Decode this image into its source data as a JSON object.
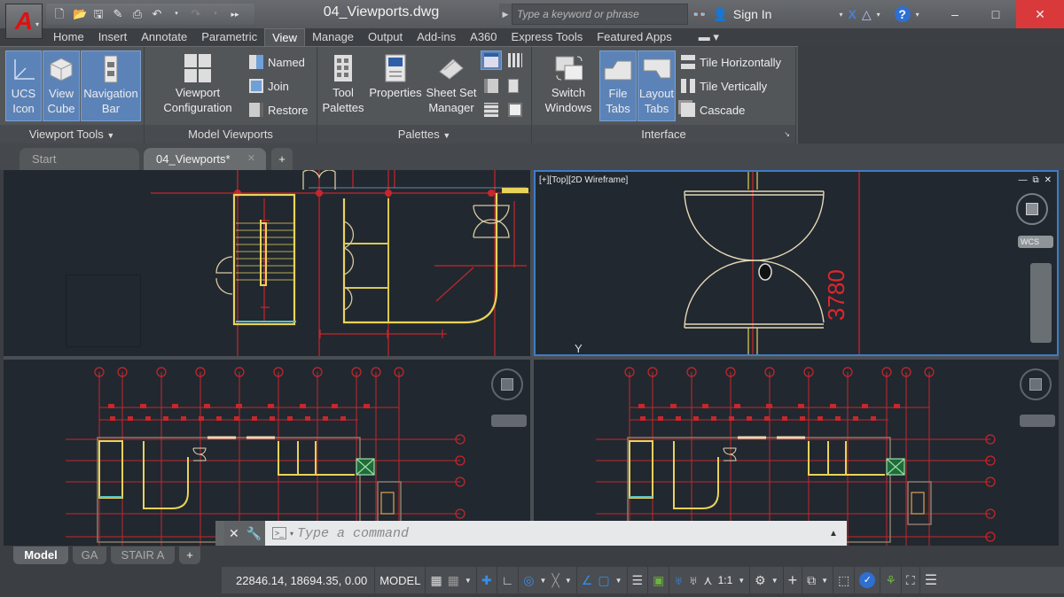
{
  "app": {
    "logo_letter": "A",
    "file_title": "04_Viewports.dwg"
  },
  "quick_access": [
    "new-icon",
    "open-icon",
    "save-icon",
    "save-as-icon",
    "plot-icon",
    "undo-icon",
    "redo-icon",
    "more-icon"
  ],
  "search": {
    "placeholder": "Type a keyword or phrase"
  },
  "account": {
    "sign_in_label": "Sign In"
  },
  "ribbon_tabs": [
    {
      "label": "Home"
    },
    {
      "label": "Insert"
    },
    {
      "label": "Annotate"
    },
    {
      "label": "Parametric"
    },
    {
      "label": "View",
      "active": true
    },
    {
      "label": "Manage"
    },
    {
      "label": "Output"
    },
    {
      "label": "Add-ins"
    },
    {
      "label": "A360"
    },
    {
      "label": "Express Tools"
    },
    {
      "label": "Featured Apps"
    }
  ],
  "ribbon": {
    "viewport_tools": {
      "title": "Viewport Tools",
      "ucs_icon": {
        "line1": "UCS",
        "line2": "Icon",
        "active": true
      },
      "view_cube": {
        "line1": "View",
        "line2": "Cube",
        "active": true
      },
      "navigation_bar": {
        "line1": "Navigation",
        "line2": "Bar",
        "active": true
      }
    },
    "model_viewports": {
      "title": "Model Viewports",
      "viewport_configuration": {
        "line1": "Viewport",
        "line2": "Configuration"
      },
      "named": "Named",
      "join": "Join",
      "restore": "Restore"
    },
    "palettes": {
      "title": "Palettes",
      "tool_palettes": {
        "line1": "Tool",
        "line2": "Palettes"
      },
      "properties": {
        "line1": "Properties"
      },
      "sheet_set_manager": {
        "line1": "Sheet Set",
        "line2": "Manager"
      }
    },
    "interface": {
      "title": "Interface",
      "switch_windows": {
        "line1": "Switch",
        "line2": "Windows"
      },
      "file_tabs": {
        "line1": "File",
        "line2": "Tabs",
        "active": true
      },
      "layout_tabs": {
        "line1": "Layout",
        "line2": "Tabs",
        "active": true
      },
      "tile_horizontally": "Tile Horizontally",
      "tile_vertically": "Tile Vertically",
      "cascade": "Cascade"
    }
  },
  "doc_tabs": {
    "start": "Start",
    "current": "04_Viewports*",
    "plus": "+"
  },
  "viewports": {
    "active_label": "[+][Top][2D Wireframe]",
    "dimension_text": "3780",
    "wcs_label": "WCS",
    "y_axis": "Y"
  },
  "command_line": {
    "placeholder": "Type a command"
  },
  "layout_tabs": [
    {
      "label": "Model",
      "active": true
    },
    {
      "label": "GA"
    },
    {
      "label": "STAIR A"
    },
    {
      "label": "+"
    }
  ],
  "status_bar": {
    "coordinates": "22846.14, 18694.35, 0.00",
    "space": "MODEL",
    "annotation_scale": "1:1"
  },
  "colors": {
    "accent": "#5c83b8",
    "active_viewport_border": "#3e7cc7",
    "close_button": "#d9393b",
    "drawing_red": "#e0262b",
    "drawing_yellow": "#e8d35a",
    "drawing_background": "#212830"
  }
}
